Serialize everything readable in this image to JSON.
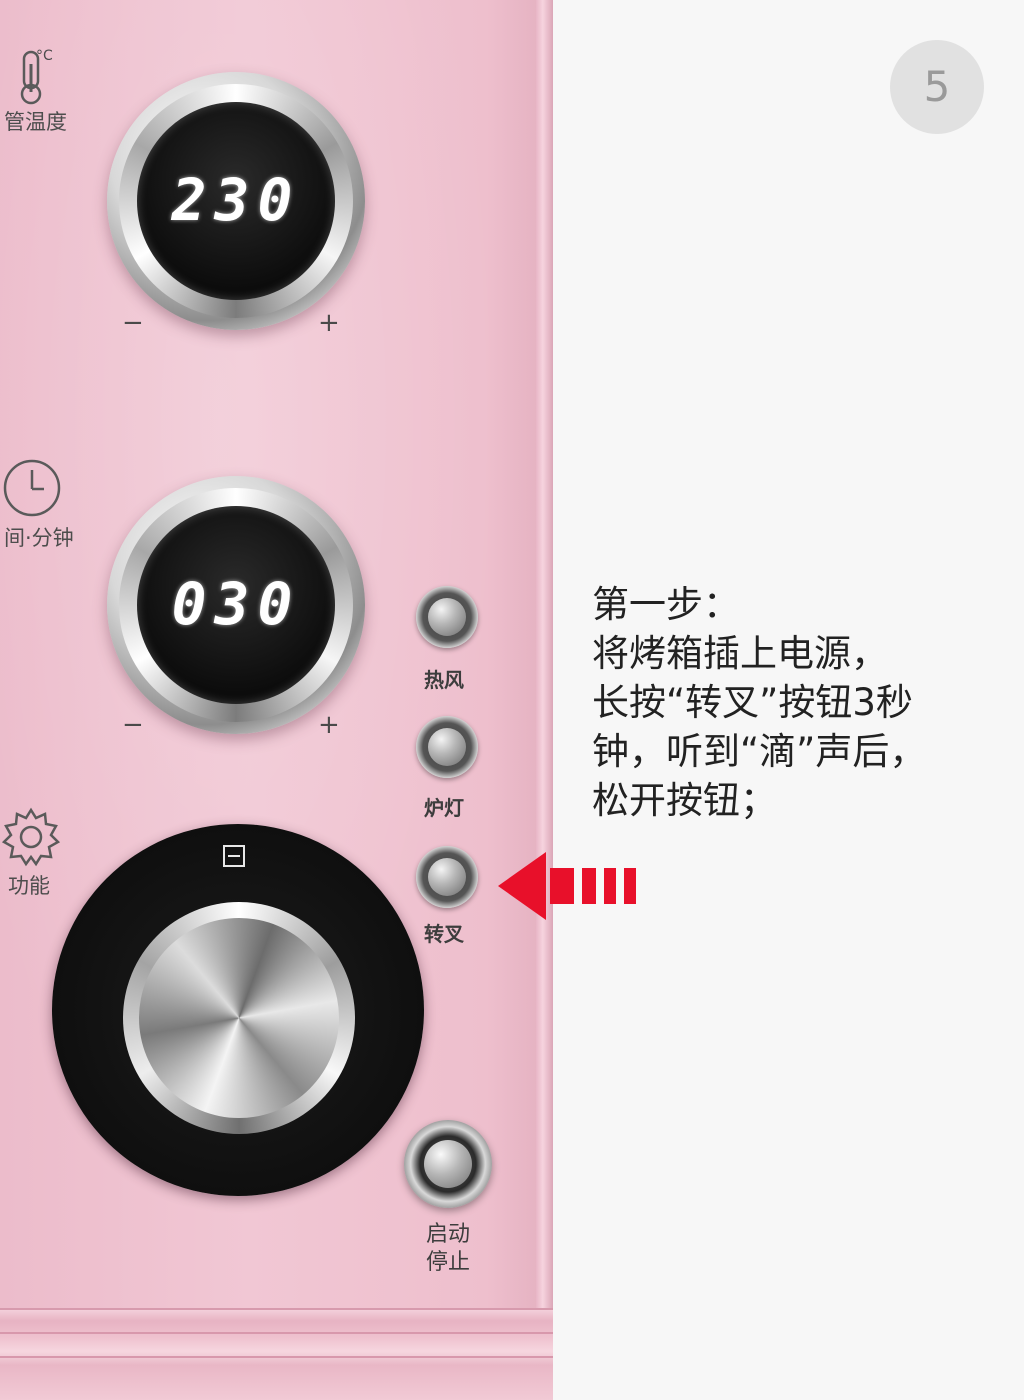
{
  "step_number": "5",
  "panel": {
    "temperature": {
      "label": "管温度",
      "value": "230",
      "minus": "−",
      "plus": "+",
      "icon": "thermometer-icon",
      "unit_mark": "°C"
    },
    "timer": {
      "label": "间·分钟",
      "value": "030",
      "minus": "−",
      "plus": "+",
      "icon": "clock-icon"
    },
    "function": {
      "label": "功能",
      "icon": "gear-icon",
      "marker_icon": "panel-mode-icon"
    },
    "buttons": {
      "convection": "热风",
      "lamp": "炉灯",
      "rotisserie": "转叉",
      "start_stop_line1": "启动",
      "start_stop_line2": "停止"
    }
  },
  "arrow": {
    "color": "#e8102a",
    "icon": "left-arrow-icon"
  },
  "instructions": {
    "line1": "第一步：",
    "line2": "将烤箱插上电源，",
    "line3": "长按“转叉”按钮3秒",
    "line4": "钟，听到“滴”声后，",
    "line5": "松开按钮；"
  }
}
